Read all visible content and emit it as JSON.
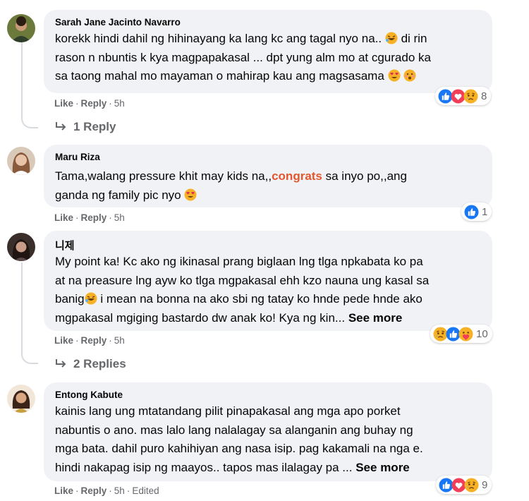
{
  "comments": [
    {
      "author": "Sarah Jane Jacinto Navarro",
      "lines": [
        "korekk hindi dahil ng hihinayang ka lang kc ang tagal nyo na..",
        "rason n nbuntis k kya magpapakasal ... dpt yung alm mo at cgurado ka",
        "sa taong mahal mo mayaman o mahirap kau ang magsasama"
      ],
      "line1_tail": "di rin",
      "like": "Like",
      "reply": "Reply",
      "time": "5h",
      "reaction_count": "8",
      "replies_label": "1 Reply"
    },
    {
      "author": "Maru Riza",
      "line1_pre": "Tama,walang pressure khit may kids na,,",
      "highlight": "congrats",
      "line1_post": "sa inyo po,,ang",
      "line2": "ganda ng family pic nyo",
      "like": "Like",
      "reply": "Reply",
      "time": "5h",
      "reaction_count": "1"
    },
    {
      "author": "니제",
      "lines": [
        "My point ka! Kc ako ng ikinasal prang biglaan lng tlga npkabata ko pa",
        "at na preasure lng ayw ko tlga mgpakasal ehh kzo nauna ung kasal sa",
        "banig",
        "mgpakasal mgiging bastardo dw anak ko! Kya ng kin..."
      ],
      "line3_tail": "i mean na bonna na ako sbi ng tatay ko hnde pede hnde ako",
      "see_more": "See more",
      "like": "Like",
      "reply": "Reply",
      "time": "5h",
      "reaction_count": "10",
      "replies_label": "2 Replies"
    },
    {
      "author": "Entong Kabute",
      "lines": [
        "kainis lang ung mtatandang pilit pinapakasal ang mga apo porket",
        "nabuntis o ano. mas lalo lang nalalagay sa alanganin ang buhay ng",
        "mga bata. dahil puro kahihiyan ang nasa isip. pag kakamali na nga e.",
        "hindi nakapag isip ng maayos.. tapos mas ilalagay pa ..."
      ],
      "see_more": "See more",
      "like": "Like",
      "reply": "Reply",
      "time": "5h",
      "edited": "Edited",
      "reaction_count": "9"
    }
  ],
  "colors": {
    "bubble": "#f0f2f5",
    "meta_text": "#65676b",
    "highlight": "#e4572e",
    "like_blue": "#1877f2",
    "love_red": "#f33e58",
    "haha_yellow": "#f7b125"
  },
  "icons": [
    "like-reaction-icon",
    "love-reaction-icon",
    "sad-reaction-icon",
    "care-reaction-icon",
    "haha-emoji-icon",
    "heart-eyes-emoji-icon",
    "smirk-emoji-icon",
    "reply-arrow-icon"
  ]
}
